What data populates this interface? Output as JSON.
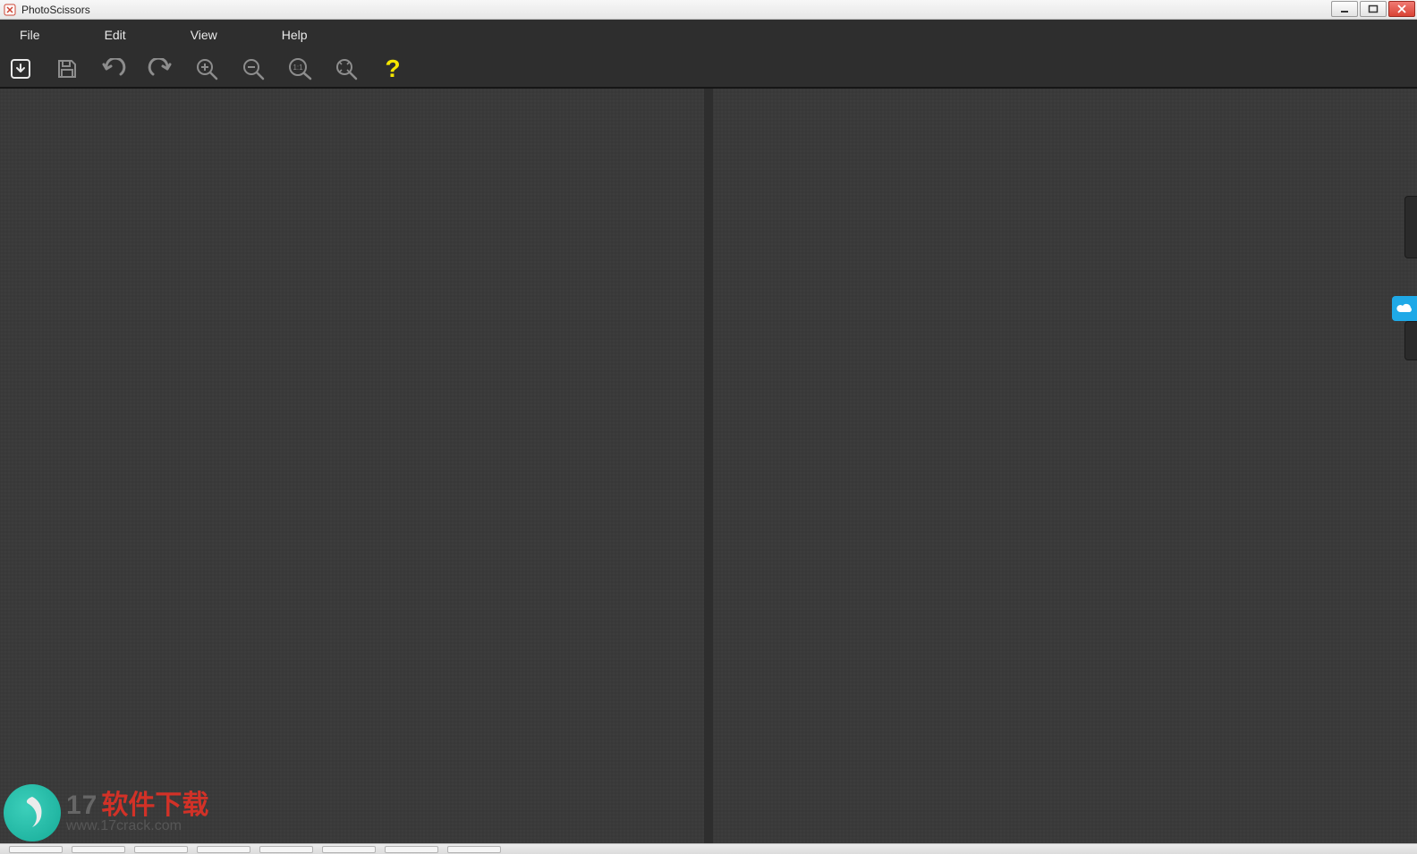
{
  "window": {
    "title": "PhotoScissors"
  },
  "menu": {
    "items": [
      "File",
      "Edit",
      "View",
      "Help"
    ]
  },
  "toolbar": {
    "open_label": "Open image",
    "save_label": "Save image",
    "undo_label": "Undo",
    "redo_label": "Redo",
    "zoom_in_label": "Zoom in",
    "zoom_out_label": "Zoom out",
    "zoom_actual_label": "Actual size",
    "zoom_fit_label": "Fit to window",
    "help_label": "Help"
  },
  "watermark": {
    "number": "17",
    "cn": "软件下载",
    "url": "www.17crack.com"
  }
}
